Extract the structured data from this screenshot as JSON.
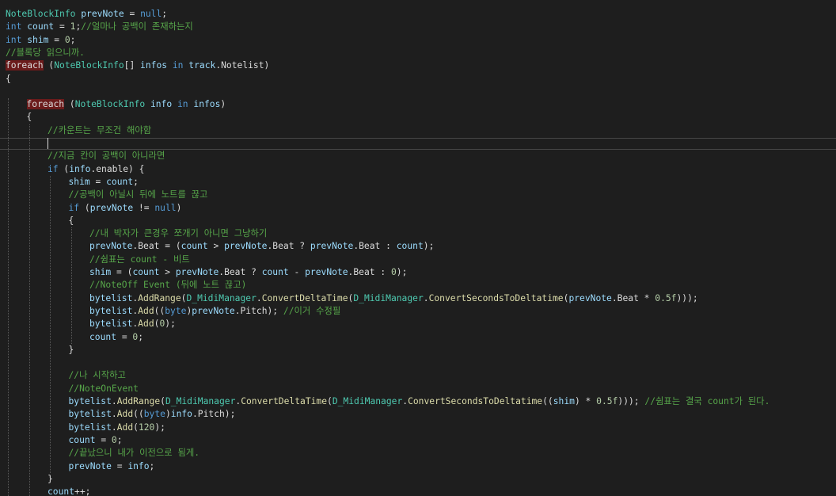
{
  "editor": {
    "colors": {
      "background": "#1e1e1e",
      "keyword": "#569cd6",
      "type": "#4ec9b0",
      "comment": "#57a64a",
      "number": "#b5cea8",
      "identifier": "#9cdcfe",
      "method": "#dcdcaa",
      "plain": "#dcdcdc",
      "highlight_background": "#6b1b1b"
    },
    "lines": [
      {
        "indent": 0,
        "segments": [
          {
            "t": "type",
            "text": "NoteBlockInfo"
          },
          {
            "t": "pl",
            "text": " "
          },
          {
            "t": "id",
            "text": "prevNote"
          },
          {
            "t": "pl",
            "text": " = "
          },
          {
            "t": "kw",
            "text": "null"
          },
          {
            "t": "pl",
            "text": ";"
          }
        ]
      },
      {
        "indent": 0,
        "segments": [
          {
            "t": "kw",
            "text": "int"
          },
          {
            "t": "pl",
            "text": " "
          },
          {
            "t": "id",
            "text": "count"
          },
          {
            "t": "pl",
            "text": " = "
          },
          {
            "t": "num",
            "text": "1"
          },
          {
            "t": "pl",
            "text": ";"
          },
          {
            "t": "cm",
            "text": "//얼마나 공백이 존재하는지"
          }
        ]
      },
      {
        "indent": 0,
        "segments": [
          {
            "t": "kw",
            "text": "int"
          },
          {
            "t": "pl",
            "text": " "
          },
          {
            "t": "id",
            "text": "shim"
          },
          {
            "t": "pl",
            "text": " = "
          },
          {
            "t": "num",
            "text": "0"
          },
          {
            "t": "pl",
            "text": ";"
          }
        ]
      },
      {
        "indent": 0,
        "segments": [
          {
            "t": "cm",
            "text": "//블록당 읽으니까."
          }
        ]
      },
      {
        "indent": 0,
        "segments": [
          {
            "t": "kw-hl",
            "text": "foreach"
          },
          {
            "t": "pl",
            "text": " ("
          },
          {
            "t": "type",
            "text": "NoteBlockInfo"
          },
          {
            "t": "pl",
            "text": "[] "
          },
          {
            "t": "id",
            "text": "infos"
          },
          {
            "t": "pl",
            "text": " "
          },
          {
            "t": "kw",
            "text": "in"
          },
          {
            "t": "pl",
            "text": " "
          },
          {
            "t": "id",
            "text": "track"
          },
          {
            "t": "pl",
            "text": ".Notelist)"
          }
        ]
      },
      {
        "indent": 0,
        "segments": [
          {
            "t": "pl",
            "text": "{"
          }
        ]
      },
      {
        "indent": 0,
        "segments": []
      },
      {
        "indent": 1,
        "segments": [
          {
            "t": "kw-hl",
            "text": "foreach"
          },
          {
            "t": "pl",
            "text": " ("
          },
          {
            "t": "type",
            "text": "NoteBlockInfo"
          },
          {
            "t": "pl",
            "text": " "
          },
          {
            "t": "id",
            "text": "info"
          },
          {
            "t": "pl",
            "text": " "
          },
          {
            "t": "kw",
            "text": "in"
          },
          {
            "t": "pl",
            "text": " "
          },
          {
            "t": "id",
            "text": "infos"
          },
          {
            "t": "pl",
            "text": ")"
          }
        ]
      },
      {
        "indent": 1,
        "segments": [
          {
            "t": "pl",
            "text": "{"
          }
        ]
      },
      {
        "indent": 2,
        "segments": [
          {
            "t": "cm",
            "text": "//카운트는 무조건 해야함"
          }
        ]
      },
      {
        "indent": 2,
        "segments": []
      },
      {
        "indent": 2,
        "segments": [
          {
            "t": "cm",
            "text": "//지금 칸이 공백이 아니라면"
          }
        ]
      },
      {
        "indent": 2,
        "segments": [
          {
            "t": "kw",
            "text": "if"
          },
          {
            "t": "pl",
            "text": " ("
          },
          {
            "t": "id",
            "text": "info"
          },
          {
            "t": "pl",
            "text": ".enable) {"
          }
        ]
      },
      {
        "indent": 3,
        "segments": [
          {
            "t": "id",
            "text": "shim"
          },
          {
            "t": "pl",
            "text": " = "
          },
          {
            "t": "id",
            "text": "count"
          },
          {
            "t": "pl",
            "text": ";"
          }
        ]
      },
      {
        "indent": 3,
        "segments": [
          {
            "t": "cm",
            "text": "//공백이 아닐시 뒤에 노트를 끊고"
          }
        ]
      },
      {
        "indent": 3,
        "segments": [
          {
            "t": "kw",
            "text": "if"
          },
          {
            "t": "pl",
            "text": " ("
          },
          {
            "t": "id",
            "text": "prevNote"
          },
          {
            "t": "pl",
            "text": " != "
          },
          {
            "t": "kw",
            "text": "null"
          },
          {
            "t": "pl",
            "text": ")"
          }
        ]
      },
      {
        "indent": 3,
        "segments": [
          {
            "t": "pl",
            "text": "{"
          }
        ]
      },
      {
        "indent": 4,
        "segments": [
          {
            "t": "cm",
            "text": "//내 박자가 큰경우 쪼개기 아니면 그냥하기"
          }
        ]
      },
      {
        "indent": 4,
        "segments": [
          {
            "t": "id",
            "text": "prevNote"
          },
          {
            "t": "pl",
            "text": ".Beat = ("
          },
          {
            "t": "id",
            "text": "count"
          },
          {
            "t": "pl",
            "text": " > "
          },
          {
            "t": "id",
            "text": "prevNote"
          },
          {
            "t": "pl",
            "text": ".Beat ? "
          },
          {
            "t": "id",
            "text": "prevNote"
          },
          {
            "t": "pl",
            "text": ".Beat : "
          },
          {
            "t": "id",
            "text": "count"
          },
          {
            "t": "pl",
            "text": ");"
          }
        ]
      },
      {
        "indent": 4,
        "segments": [
          {
            "t": "cm",
            "text": "//쉼표는 count - 비트"
          }
        ]
      },
      {
        "indent": 4,
        "segments": [
          {
            "t": "id",
            "text": "shim"
          },
          {
            "t": "pl",
            "text": " = ("
          },
          {
            "t": "id",
            "text": "count"
          },
          {
            "t": "pl",
            "text": " > "
          },
          {
            "t": "id",
            "text": "prevNote"
          },
          {
            "t": "pl",
            "text": ".Beat ? "
          },
          {
            "t": "id",
            "text": "count"
          },
          {
            "t": "pl",
            "text": " - "
          },
          {
            "t": "id",
            "text": "prevNote"
          },
          {
            "t": "pl",
            "text": ".Beat : "
          },
          {
            "t": "num",
            "text": "0"
          },
          {
            "t": "pl",
            "text": ");"
          }
        ]
      },
      {
        "indent": 4,
        "segments": [
          {
            "t": "cm",
            "text": "//NoteOff Event (뒤에 노트 끊고)"
          }
        ]
      },
      {
        "indent": 4,
        "segments": [
          {
            "t": "id",
            "text": "bytelist"
          },
          {
            "t": "pl",
            "text": "."
          },
          {
            "t": "mt",
            "text": "AddRange"
          },
          {
            "t": "pl",
            "text": "("
          },
          {
            "t": "type",
            "text": "D_MidiManager"
          },
          {
            "t": "pl",
            "text": "."
          },
          {
            "t": "mt",
            "text": "ConvertDeltaTime"
          },
          {
            "t": "pl",
            "text": "("
          },
          {
            "t": "type",
            "text": "D_MidiManager"
          },
          {
            "t": "pl",
            "text": "."
          },
          {
            "t": "mt",
            "text": "ConvertSecondsToDeltatime"
          },
          {
            "t": "pl",
            "text": "("
          },
          {
            "t": "id",
            "text": "prevNote"
          },
          {
            "t": "pl",
            "text": ".Beat * "
          },
          {
            "t": "num",
            "text": "0.5f"
          },
          {
            "t": "pl",
            "text": ")));"
          }
        ]
      },
      {
        "indent": 4,
        "segments": [
          {
            "t": "id",
            "text": "bytelist"
          },
          {
            "t": "pl",
            "text": "."
          },
          {
            "t": "mt",
            "text": "Add"
          },
          {
            "t": "pl",
            "text": "(("
          },
          {
            "t": "kw",
            "text": "byte"
          },
          {
            "t": "pl",
            "text": ")"
          },
          {
            "t": "id",
            "text": "prevNote"
          },
          {
            "t": "pl",
            "text": ".Pitch); "
          },
          {
            "t": "cm",
            "text": "//이거 수정필"
          }
        ]
      },
      {
        "indent": 4,
        "segments": [
          {
            "t": "id",
            "text": "bytelist"
          },
          {
            "t": "pl",
            "text": "."
          },
          {
            "t": "mt",
            "text": "Add"
          },
          {
            "t": "pl",
            "text": "("
          },
          {
            "t": "num",
            "text": "0"
          },
          {
            "t": "pl",
            "text": ");"
          }
        ]
      },
      {
        "indent": 4,
        "segments": [
          {
            "t": "id",
            "text": "count"
          },
          {
            "t": "pl",
            "text": " = "
          },
          {
            "t": "num",
            "text": "0"
          },
          {
            "t": "pl",
            "text": ";"
          }
        ]
      },
      {
        "indent": 3,
        "segments": [
          {
            "t": "pl",
            "text": "}"
          }
        ]
      },
      {
        "indent": 3,
        "segments": []
      },
      {
        "indent": 3,
        "segments": [
          {
            "t": "cm",
            "text": "//나 시작하고"
          }
        ]
      },
      {
        "indent": 3,
        "segments": [
          {
            "t": "cm",
            "text": "//NoteOnEvent"
          }
        ]
      },
      {
        "indent": 3,
        "segments": [
          {
            "t": "id",
            "text": "bytelist"
          },
          {
            "t": "pl",
            "text": "."
          },
          {
            "t": "mt",
            "text": "AddRange"
          },
          {
            "t": "pl",
            "text": "("
          },
          {
            "t": "type",
            "text": "D_MidiManager"
          },
          {
            "t": "pl",
            "text": "."
          },
          {
            "t": "mt",
            "text": "ConvertDeltaTime"
          },
          {
            "t": "pl",
            "text": "("
          },
          {
            "t": "type",
            "text": "D_MidiManager"
          },
          {
            "t": "pl",
            "text": "."
          },
          {
            "t": "mt",
            "text": "ConvertSecondsToDeltatime"
          },
          {
            "t": "pl",
            "text": "(("
          },
          {
            "t": "id",
            "text": "shim"
          },
          {
            "t": "pl",
            "text": ") * "
          },
          {
            "t": "num",
            "text": "0.5f"
          },
          {
            "t": "pl",
            "text": "))); "
          },
          {
            "t": "cm",
            "text": "//쉼표는 결국 count가 된다."
          }
        ]
      },
      {
        "indent": 3,
        "segments": [
          {
            "t": "id",
            "text": "bytelist"
          },
          {
            "t": "pl",
            "text": "."
          },
          {
            "t": "mt",
            "text": "Add"
          },
          {
            "t": "pl",
            "text": "(("
          },
          {
            "t": "kw",
            "text": "byte"
          },
          {
            "t": "pl",
            "text": ")"
          },
          {
            "t": "id",
            "text": "info"
          },
          {
            "t": "pl",
            "text": ".Pitch);"
          }
        ]
      },
      {
        "indent": 3,
        "segments": [
          {
            "t": "id",
            "text": "bytelist"
          },
          {
            "t": "pl",
            "text": "."
          },
          {
            "t": "mt",
            "text": "Add"
          },
          {
            "t": "pl",
            "text": "("
          },
          {
            "t": "num",
            "text": "120"
          },
          {
            "t": "pl",
            "text": ");"
          }
        ]
      },
      {
        "indent": 3,
        "segments": [
          {
            "t": "id",
            "text": "count"
          },
          {
            "t": "pl",
            "text": " = "
          },
          {
            "t": "num",
            "text": "0"
          },
          {
            "t": "pl",
            "text": ";"
          }
        ]
      },
      {
        "indent": 3,
        "segments": [
          {
            "t": "cm",
            "text": "//끝났으니 내가 이전으로 됨게."
          }
        ]
      },
      {
        "indent": 3,
        "segments": [
          {
            "t": "id",
            "text": "prevNote"
          },
          {
            "t": "pl",
            "text": " = "
          },
          {
            "t": "id",
            "text": "info"
          },
          {
            "t": "pl",
            "text": ";"
          }
        ]
      },
      {
        "indent": 2,
        "segments": [
          {
            "t": "pl",
            "text": "}"
          }
        ]
      },
      {
        "indent": 2,
        "segments": [
          {
            "t": "id",
            "text": "count"
          },
          {
            "t": "pl",
            "text": "++;"
          }
        ]
      }
    ]
  }
}
